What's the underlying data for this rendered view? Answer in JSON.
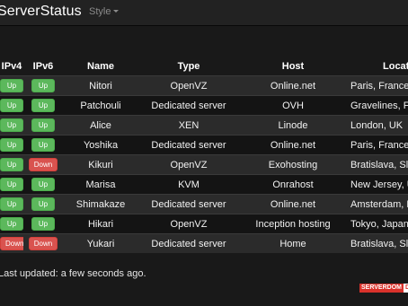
{
  "navbar": {
    "brand": "ServerStatus",
    "style_menu": "Style"
  },
  "table": {
    "headers": {
      "ipv4": "IPv4",
      "ipv6": "IPv6",
      "name": "Name",
      "type": "Type",
      "host": "Host",
      "location": "Location"
    },
    "rows": [
      {
        "ipv4": "Up",
        "ipv6": "Up",
        "name": "Nitori",
        "type": "OpenVZ",
        "host": "Online.net",
        "location": "Paris, France"
      },
      {
        "ipv4": "Up",
        "ipv6": "Up",
        "name": "Patchouli",
        "type": "Dedicated server",
        "host": "OVH",
        "location": "Gravelines, France"
      },
      {
        "ipv4": "Up",
        "ipv6": "Up",
        "name": "Alice",
        "type": "XEN",
        "host": "Linode",
        "location": "London, UK"
      },
      {
        "ipv4": "Up",
        "ipv6": "Up",
        "name": "Yoshika",
        "type": "Dedicated server",
        "host": "Online.net",
        "location": "Paris, France"
      },
      {
        "ipv4": "Up",
        "ipv6": "Down",
        "name": "Kikuri",
        "type": "OpenVZ",
        "host": "Exohosting",
        "location": "Bratislava, Slovakia"
      },
      {
        "ipv4": "Up",
        "ipv6": "Up",
        "name": "Marisa",
        "type": "KVM",
        "host": "Onrahost",
        "location": "New Jersey, United States"
      },
      {
        "ipv4": "Up",
        "ipv6": "Up",
        "name": "Shimakaze",
        "type": "Dedicated server",
        "host": "Online.net",
        "location": "Amsterdam, Netherlands"
      },
      {
        "ipv4": "Up",
        "ipv6": "Up",
        "name": "Hikari",
        "type": "OpenVZ",
        "host": "Inception hosting",
        "location": "Tokyo, Japan"
      },
      {
        "ipv4": "Down",
        "ipv6": "Down",
        "name": "Yukari",
        "type": "Dedicated server",
        "host": "Home",
        "location": "Bratislava, Slovakia"
      }
    ]
  },
  "footer": {
    "last_updated": "Last updated: a few seconds ago.",
    "logo_part1": "SERVERDOM",
    "logo_part2": "DR"
  },
  "colors": {
    "up": "#5cb85c",
    "down": "#d9534f",
    "background": "#191919",
    "navbar": "#222222"
  }
}
